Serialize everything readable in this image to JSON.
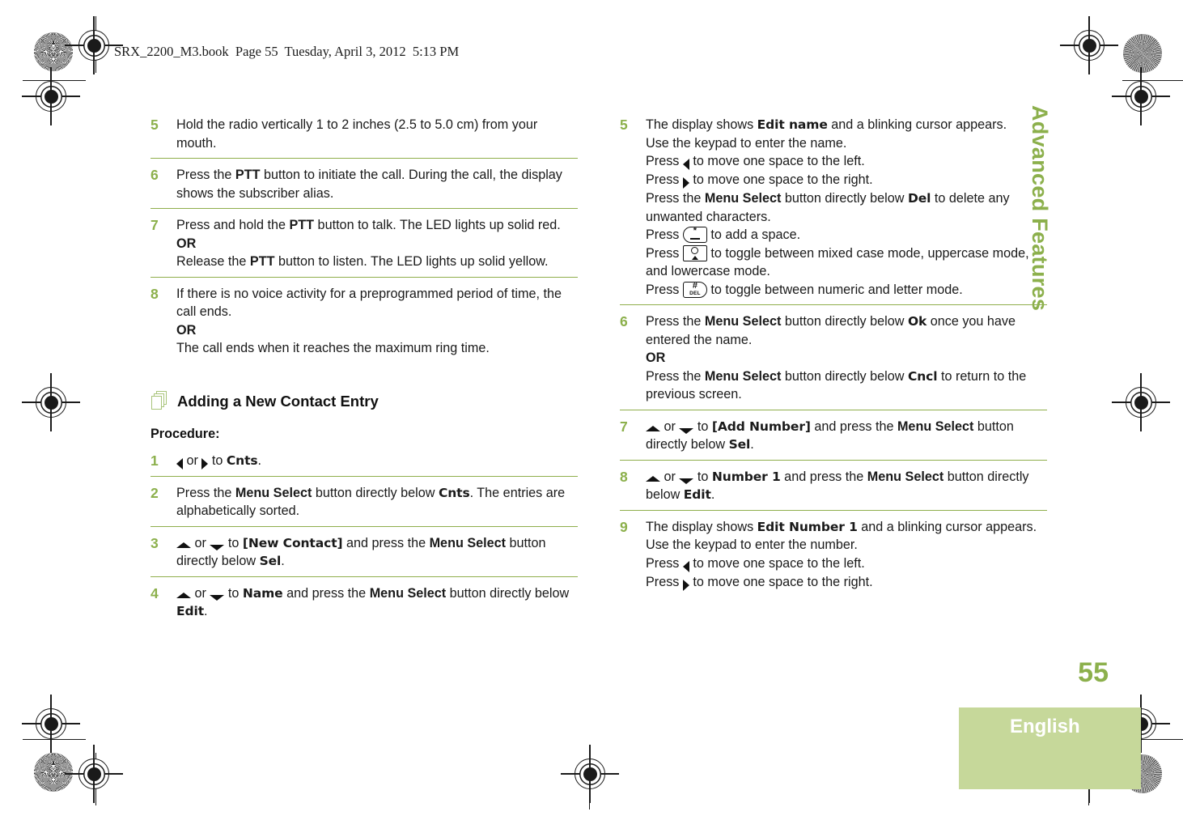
{
  "slug": "SRX_2200_M3.book  Page 55  Tuesday, April 3, 2012  5:13 PM",
  "side_title": "Advanced Features",
  "page_number": "55",
  "language": "English",
  "colors": {
    "accent_green": "#8cb04c",
    "rule_green": "#8fae4b",
    "band_green": "#c6d89a",
    "icon_green": "#a8c47a"
  },
  "section": {
    "heading": "Adding a New Contact Entry",
    "icon": "stacked-pages-icon",
    "procedure_label": "Procedure:"
  },
  "labels": {
    "or": "OR",
    "ptt": "PTT",
    "menu_select": "Menu Select",
    "cnts": "Cnts",
    "sel": "Sel",
    "name": "Name",
    "edit": "Edit",
    "new_contact": "[New Contact]",
    "edit_name": "Edit name",
    "del": "Del",
    "ok": "Ok",
    "cncl": "Cncl",
    "add_number": "[Add Number]",
    "number_1": "Number 1",
    "edit_number_1": "Edit Number 1"
  },
  "keys": {
    "star_key": {
      "top": "*",
      "bottom": "",
      "shape": "rounded-left",
      "name": "star-key-icon"
    },
    "shift_key": {
      "top": "",
      "bottom": "",
      "shape": "square",
      "name": "shift-key-icon"
    },
    "hash_key": {
      "top": "#",
      "bottom": "DEL",
      "shape": "rounded-right",
      "name": "hash-del-key-icon"
    }
  },
  "left_column": {
    "steps": [
      {
        "num": "5",
        "lines": [
          {
            "parts": [
              {
                "t": "Hold the radio vertically 1 to 2 inches (2.5 to 5.0 cm) from your mouth."
              }
            ]
          }
        ]
      },
      {
        "num": "6",
        "lines": [
          {
            "parts": [
              {
                "t": "Press the "
              },
              {
                "t": "PTT",
                "s": "b"
              },
              {
                "t": " button to initiate the call. During the call, the display shows the subscriber alias."
              }
            ]
          }
        ]
      },
      {
        "num": "7",
        "lines": [
          {
            "parts": [
              {
                "t": "Press and hold the "
              },
              {
                "t": "PTT",
                "s": "b"
              },
              {
                "t": " button to talk. The LED lights up solid red."
              }
            ]
          },
          {
            "parts": [
              {
                "t": "OR",
                "s": "b"
              }
            ]
          },
          {
            "parts": [
              {
                "t": "Release the "
              },
              {
                "t": "PTT",
                "s": "b"
              },
              {
                "t": " button to listen. The LED lights up solid yellow."
              }
            ]
          }
        ]
      },
      {
        "num": "8",
        "lines": [
          {
            "parts": [
              {
                "t": "If there is no voice activity for a preprogrammed period of time, the call ends."
              }
            ]
          },
          {
            "parts": [
              {
                "t": "OR",
                "s": "b"
              }
            ]
          },
          {
            "parts": [
              {
                "t": "The call ends when it reaches the maximum ring time."
              }
            ]
          }
        ]
      }
    ],
    "procedure_steps": [
      {
        "num": "1",
        "lines": [
          {
            "parts": [
              {
                "g": "nav-left"
              },
              {
                "t": " or "
              },
              {
                "g": "nav-right"
              },
              {
                "t": " to "
              },
              {
                "t": "Cnts",
                "s": "ui"
              },
              {
                "t": "."
              }
            ]
          }
        ]
      },
      {
        "num": "2",
        "lines": [
          {
            "parts": [
              {
                "t": "Press the "
              },
              {
                "t": "Menu Select",
                "s": "b"
              },
              {
                "t": " button directly below "
              },
              {
                "t": "Cnts",
                "s": "ui"
              },
              {
                "t": ". The entries are alphabetically sorted."
              }
            ]
          }
        ]
      },
      {
        "num": "3",
        "lines": [
          {
            "parts": [
              {
                "g": "nav-up"
              },
              {
                "t": " or "
              },
              {
                "g": "nav-down"
              },
              {
                "t": " to "
              },
              {
                "t": "[New Contact]",
                "s": "ui"
              },
              {
                "t": " and press the "
              },
              {
                "t": "Menu Select",
                "s": "b"
              },
              {
                "t": " button directly below "
              },
              {
                "t": "Sel",
                "s": "ui"
              },
              {
                "t": "."
              }
            ]
          }
        ]
      },
      {
        "num": "4",
        "lines": [
          {
            "parts": [
              {
                "g": "nav-up"
              },
              {
                "t": " or "
              },
              {
                "g": "nav-down"
              },
              {
                "t": " to "
              },
              {
                "t": "Name",
                "s": "ui"
              },
              {
                "t": " and press the "
              },
              {
                "t": "Menu Select",
                "s": "b"
              },
              {
                "t": " button directly below "
              },
              {
                "t": "Edit",
                "s": "ui"
              },
              {
                "t": "."
              }
            ]
          }
        ]
      }
    ]
  },
  "right_column": {
    "steps": [
      {
        "num": "5",
        "lines": [
          {
            "parts": [
              {
                "t": "The display shows "
              },
              {
                "t": "Edit name",
                "s": "ui"
              },
              {
                "t": " and a blinking cursor appears."
              }
            ]
          },
          {
            "parts": [
              {
                "t": "Use the keypad to enter the name."
              }
            ]
          },
          {
            "parts": [
              {
                "t": "Press "
              },
              {
                "g": "nav-left"
              },
              {
                "t": " to move one space to the left."
              }
            ]
          },
          {
            "parts": [
              {
                "t": "Press "
              },
              {
                "g": "nav-right"
              },
              {
                "t": " to move one space to the right."
              }
            ]
          },
          {
            "parts": [
              {
                "t": "Press the "
              },
              {
                "t": "Menu Select",
                "s": "b"
              },
              {
                "t": " button directly below "
              },
              {
                "t": "Del",
                "s": "ui"
              },
              {
                "t": " to delete any unwanted characters."
              }
            ]
          },
          {
            "parts": [
              {
                "t": "Press "
              },
              {
                "g": "key-star"
              },
              {
                "t": " to add a space."
              }
            ]
          },
          {
            "parts": [
              {
                "t": "Press "
              },
              {
                "g": "key-shift"
              },
              {
                "t": " to toggle between mixed case mode, uppercase mode, and lowercase mode."
              }
            ]
          },
          {
            "parts": [
              {
                "t": "Press "
              },
              {
                "g": "key-hash"
              },
              {
                "t": " to toggle between numeric and letter mode."
              }
            ]
          }
        ]
      },
      {
        "num": "6",
        "lines": [
          {
            "parts": [
              {
                "t": "Press the "
              },
              {
                "t": "Menu Select",
                "s": "b"
              },
              {
                "t": " button directly below "
              },
              {
                "t": "Ok",
                "s": "ui"
              },
              {
                "t": " once you have entered the name."
              }
            ]
          },
          {
            "parts": [
              {
                "t": "OR",
                "s": "b"
              }
            ]
          },
          {
            "parts": [
              {
                "t": "Press the "
              },
              {
                "t": "Menu Select",
                "s": "b"
              },
              {
                "t": " button directly below "
              },
              {
                "t": "Cncl",
                "s": "ui"
              },
              {
                "t": " to return to the previous screen."
              }
            ]
          }
        ]
      },
      {
        "num": "7",
        "lines": [
          {
            "parts": [
              {
                "g": "nav-up"
              },
              {
                "t": " or "
              },
              {
                "g": "nav-down"
              },
              {
                "t": " to "
              },
              {
                "t": "[Add Number]",
                "s": "ui"
              },
              {
                "t": " and press the "
              },
              {
                "t": "Menu Select",
                "s": "b"
              },
              {
                "t": " button directly below "
              },
              {
                "t": "Sel",
                "s": "ui"
              },
              {
                "t": "."
              }
            ]
          }
        ]
      },
      {
        "num": "8",
        "lines": [
          {
            "parts": [
              {
                "g": "nav-up"
              },
              {
                "t": " or "
              },
              {
                "g": "nav-down"
              },
              {
                "t": " to "
              },
              {
                "t": "Number 1",
                "s": "ui"
              },
              {
                "t": " and press the "
              },
              {
                "t": "Menu Select",
                "s": "b"
              },
              {
                "t": " button directly below "
              },
              {
                "t": "Edit",
                "s": "ui"
              },
              {
                "t": "."
              }
            ]
          }
        ]
      },
      {
        "num": "9",
        "lines": [
          {
            "parts": [
              {
                "t": "The display shows "
              },
              {
                "t": "Edit Number 1",
                "s": "ui"
              },
              {
                "t": " and a blinking cursor appears."
              }
            ]
          },
          {
            "parts": [
              {
                "t": "Use the keypad to enter the number."
              }
            ]
          },
          {
            "parts": [
              {
                "t": "Press "
              },
              {
                "g": "nav-left"
              },
              {
                "t": " to move one space to the left."
              }
            ]
          },
          {
            "parts": [
              {
                "t": "Press "
              },
              {
                "g": "nav-right"
              },
              {
                "t": " to move one space to the right."
              }
            ]
          }
        ]
      }
    ]
  }
}
